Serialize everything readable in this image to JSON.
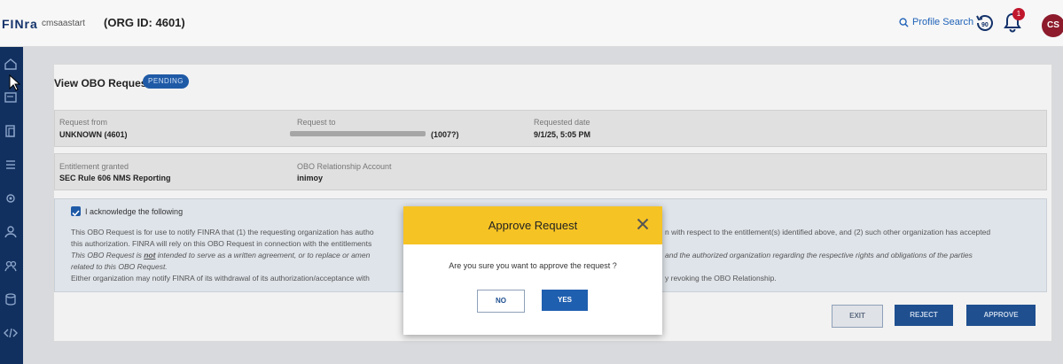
{
  "header": {
    "logo": "FINra",
    "user": "cmsaastart",
    "org": "(ORG ID: 4601)",
    "profile_search": "Profile Search",
    "notification_count": "1",
    "avatar_initials": "CS"
  },
  "page": {
    "title": "View OBO Request",
    "status": "PENDING"
  },
  "fields": {
    "request_from_label": "Request from",
    "request_from_value": "UNKNOWN (4601)",
    "request_to_label": "Request to",
    "request_to_value": "(1007?)",
    "requested_date_label": "Requested date",
    "requested_date_value": "9/1/25, 5:05 PM",
    "entitlement_label": "Entitlement granted",
    "entitlement_value": "SEC Rule 606 NMS Reporting",
    "obo_account_label": "OBO Relationship Account",
    "obo_account_value": "inimoy"
  },
  "acknowledgement": {
    "heading": "I acknowledge the following",
    "line1_left": "This OBO Request is for use to notify FINRA that (1) the requesting organization has autho",
    "line1_right": "n with respect to the entitlement(s) identified above, and (2) such other organization has accepted",
    "line2_left": "this authorization. FINRA will rely on this OBO Request in connection with the entitlements",
    "line3_pre": "This OBO Request is ",
    "line3_not": "not",
    "line3_left": " intended to serve as a written agreement, or to replace or amen",
    "line3_right": "and the authorized organization regarding the respective rights and obligations of the parties",
    "line4_left": "related to this OBO Request.",
    "line5_left": "Either organization may notify FINRA of its withdrawal of its authorization/acceptance with",
    "line5_right": "y revoking the OBO Relationship."
  },
  "actions": {
    "exit": "EXIT",
    "reject": "REJECT",
    "approve": "APPROVE"
  },
  "modal": {
    "title": "Approve Request",
    "message": "Are you sure you want to approve the request ?",
    "no": "NO",
    "yes": "YES"
  },
  "colors": {
    "sidebar": "#12305f",
    "modal_header": "#f6c324",
    "primary": "#1f5fb0"
  }
}
